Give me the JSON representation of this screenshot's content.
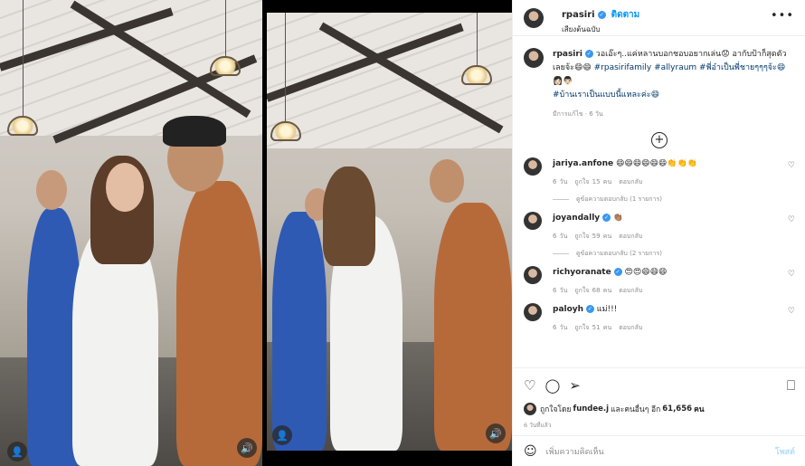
{
  "header": {
    "username": "rpasiri",
    "follow_label": "ติดตาม",
    "subtitle": "เสียงต้นฉบับ",
    "more_icon": "more-icon"
  },
  "caption": {
    "username": "rpasiri",
    "text": " วอเอ๊ะๆ..แค่หลานบอกชอบอยากเล่น😟 อากับป้าก็สุดตัวเลยจ้ะ😄😄 ",
    "tags1": "#rpasirifamily #allyraum #พี่อ๋าเป็นพี่ชายๆๆๆจ้ะ😄👩🏻👨🏻",
    "tags2": "#บ้านเราเป็นแบบนี้แหละค่ะ😄",
    "meta": "มีการแก้ไข · 6 วัน"
  },
  "comments": [
    {
      "username": "jariya.anfone",
      "text": " 😄😄😄😄😄😄👏👏👏",
      "time": "6 วัน",
      "likes": "ถูกใจ 15 คน",
      "reply": "ตอบกลับ",
      "replies": "ดูข้อความตอบกลับ (1 รายการ)",
      "verified": false
    },
    {
      "username": "joyandally",
      "text": " 👏🏽",
      "time": "6 วัน",
      "likes": "ถูกใจ 59 คน",
      "reply": "ตอบกลับ",
      "replies": "ดูข้อความตอบกลับ (2 รายการ)",
      "verified": true
    },
    {
      "username": "richyoranate",
      "text": " 😍😍😄😄😄",
      "time": "6 วัน",
      "likes": "ถูกใจ 68 คน",
      "reply": "ตอบกลับ",
      "replies": "",
      "verified": true
    },
    {
      "username": "paloyh",
      "text": " แม่!!!",
      "time": "6 วัน",
      "likes": "ถูกใจ 51 คน",
      "reply": "ตอบกลับ",
      "replies": "",
      "verified": true
    }
  ],
  "actions": {
    "liked_by": "ถูกใจโดย ",
    "liker": "fundee.j",
    "and_others": " และคนอื่นๆ อีก ",
    "like_count": "61,656",
    "unit": " คน",
    "time_ago": "6 วันที่แล้ว"
  },
  "add_comment": {
    "placeholder": "เพิ่มความคิดเห็น",
    "post_label": "โพสต์"
  },
  "colors": {
    "link": "#0095f6",
    "verified": "#3897f0",
    "muted": "#8e8e8e"
  }
}
